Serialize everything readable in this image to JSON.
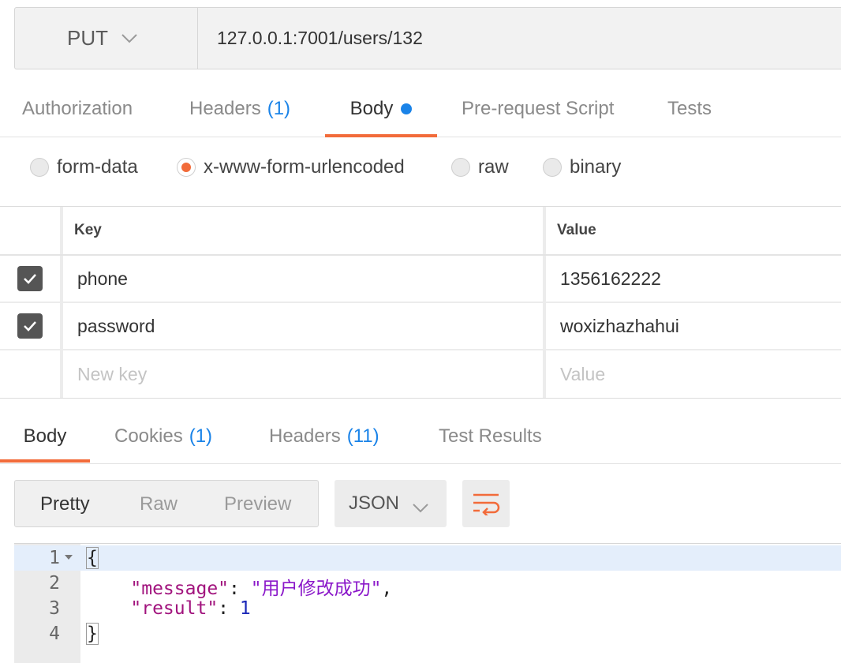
{
  "request": {
    "method": "PUT",
    "url": "127.0.0.1:7001/users/132"
  },
  "request_tabs": [
    {
      "label": "Authorization",
      "count": ""
    },
    {
      "label": "Headers",
      "count": "(1)"
    },
    {
      "label": "Body",
      "count": ""
    },
    {
      "label": "Pre-request Script",
      "count": ""
    },
    {
      "label": "Tests",
      "count": ""
    }
  ],
  "body_types": [
    "form-data",
    "x-www-form-urlencoded",
    "raw",
    "binary"
  ],
  "selected_body_type": "x-www-form-urlencoded",
  "params": {
    "key_header": "Key",
    "value_header": "Value",
    "rows": [
      {
        "key": "phone",
        "value": "1356162222",
        "checked": true
      },
      {
        "key": "password",
        "value": "woxizhazhahui",
        "checked": true
      }
    ],
    "new_key_placeholder": "New key",
    "new_value_placeholder": "Value"
  },
  "response_tabs": [
    {
      "label": "Body",
      "count": ""
    },
    {
      "label": "Cookies",
      "count": "(1)"
    },
    {
      "label": "Headers",
      "count": "(11)"
    },
    {
      "label": "Test Results",
      "count": ""
    }
  ],
  "view_modes": [
    "Pretty",
    "Raw",
    "Preview"
  ],
  "format": "JSON",
  "code": {
    "line_numbers": [
      "1",
      "2",
      "3",
      "4"
    ],
    "open_brace": "{",
    "message_key": "\"message\"",
    "message_value": "\"用户修改成功\"",
    "result_key": "\"result\"",
    "result_value": "1",
    "close_brace": "}"
  },
  "colors": {
    "accent": "#f26b3a",
    "link_blue": "#1a83e8"
  }
}
